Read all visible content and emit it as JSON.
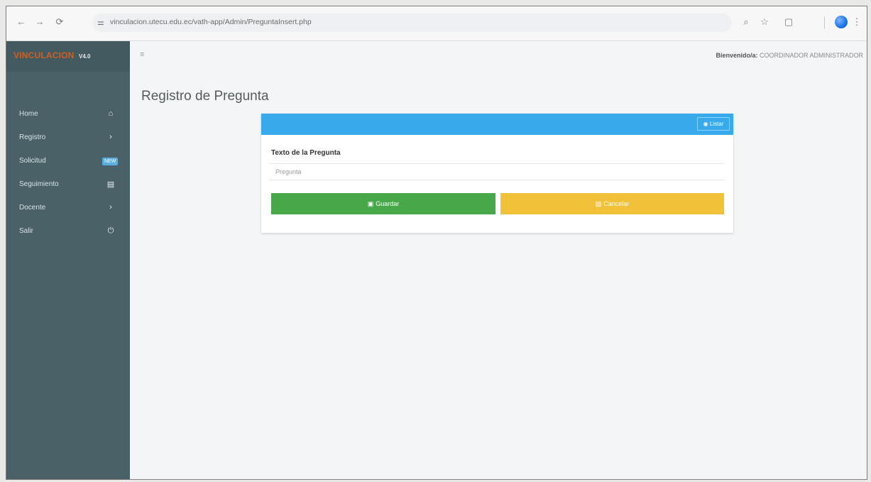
{
  "browser": {
    "url": "vinculacion.utecu.edu.ec/vath-app/Admin/PreguntaInsert.php"
  },
  "sidebar": {
    "brand": "VINCULACION",
    "version": "V4.0",
    "items": [
      {
        "label": "Home",
        "icon": "home-icon",
        "glyph": "⌂"
      },
      {
        "label": "Registro",
        "icon": "chevron-right-icon",
        "glyph": "›"
      },
      {
        "label": "Solicitud",
        "icon": "new-badge",
        "badge": "NEW"
      },
      {
        "label": "Seguimiento",
        "icon": "file-icon",
        "glyph": "▤"
      },
      {
        "label": "Docente",
        "icon": "chevron-right-icon",
        "glyph": "›"
      },
      {
        "label": "Salir",
        "icon": "power-icon",
        "glyph": "⏻"
      }
    ]
  },
  "topbar": {
    "welcome_label": "Bienvenido/a:",
    "welcome_user": "COORDINADOR ADMINISTRADOR"
  },
  "page": {
    "title": "Registro de Pregunta"
  },
  "form": {
    "list_button": "Listar",
    "field_label": "Texto de la Pregunta",
    "field_placeholder": "Pregunta",
    "save_label": "Guardar",
    "cancel_label": "Cancelar"
  },
  "colors": {
    "sidebar": "#4a6168",
    "card_header": "#38aaec",
    "save_button": "#47a84a",
    "cancel_button": "#f2c13a",
    "brand": "#d0601f"
  }
}
